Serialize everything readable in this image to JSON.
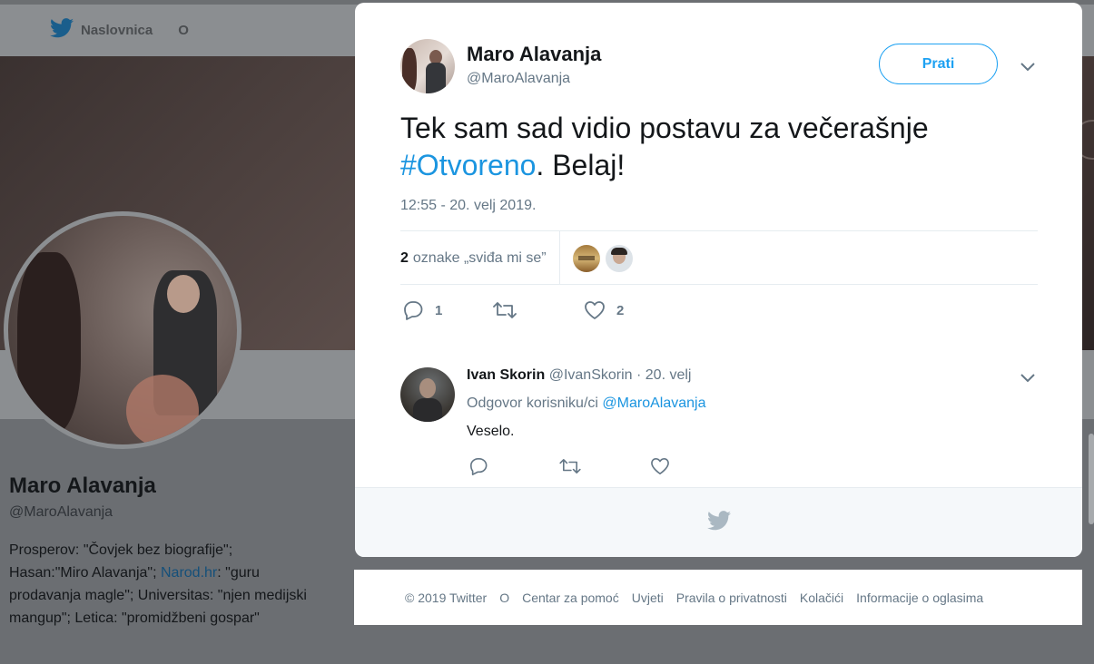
{
  "background": {
    "nav": {
      "home_label": "Naslovnica",
      "about_label": "O"
    },
    "profile": {
      "name": "Maro Alavanja",
      "handle": "@MaroAlavanja",
      "bio_part1": "Prosperov: \"Čovjek bez biografije\"; Hasan:\"Miro Alavanja\"; ",
      "bio_link": "Narod.hr",
      "bio_part2": ": \"guru prodavanja magle\"; Universitas: \"njen medijski mangup\"; Letica: \"promidžbeni gospar\""
    }
  },
  "tweet": {
    "author_name": "Maro Alavanja",
    "author_handle": "@MaroAlavanja",
    "follow_label": "Prati",
    "text_part1": "Tek sam sad vidio postavu za večerašnje ",
    "hashtag": "#Otvoreno",
    "text_part2": ". Belaj!",
    "timestamp": "12:55 - 20. velj 2019.",
    "likes_count": "2",
    "likes_label": "oznake „sviđa mi se”",
    "reply_count": "1",
    "retweet_count": "",
    "like_count": "2"
  },
  "reply": {
    "author_name": "Ivan Skorin",
    "author_handle": "@IvanSkorin",
    "date": " · 20. velj",
    "reply_to_label": "Odgovor korisniku/ci ",
    "reply_to_mention": "@MaroAlavanja",
    "text": "Veselo."
  },
  "footer": {
    "copyright": "© 2019 Twitter",
    "about": "O",
    "help": "Centar za pomoć",
    "terms": "Uvjeti",
    "privacy": "Pravila o privatnosti",
    "cookies": "Kolačići",
    "ads": "Informacije o oglasima"
  },
  "colors": {
    "accent": "#1da1f2",
    "link": "#1b95e0",
    "muted_text": "#657786",
    "overlay_bg": "#6b6e72"
  },
  "icons": [
    "twitter-bird-icon",
    "chevron-down-icon",
    "reply-icon",
    "retweet-icon",
    "heart-icon"
  ]
}
